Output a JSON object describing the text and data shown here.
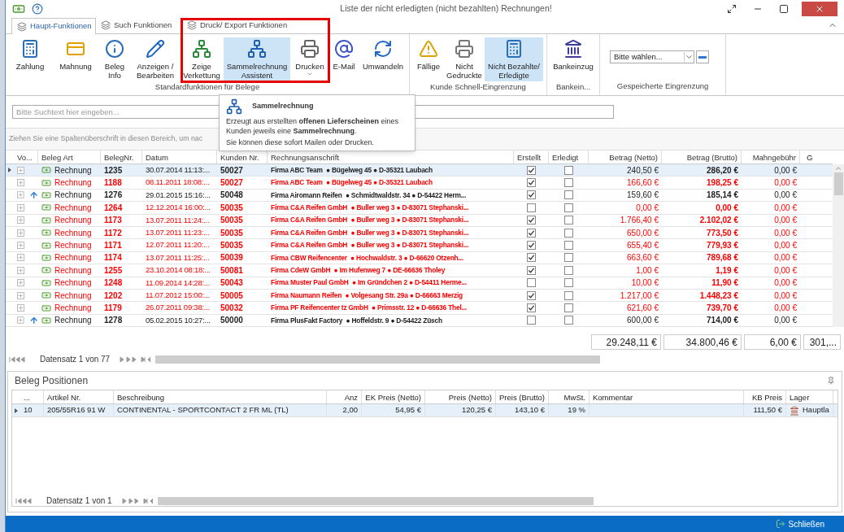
{
  "window": {
    "title": "Liste der nicht erledigten (nicht bezahlten) Rechnungen!"
  },
  "tabs": [
    {
      "label": "Haupt-Funktionen",
      "selected": true
    },
    {
      "label": "Such Funktionen",
      "selected": false
    },
    {
      "label": "Druck/ Export Funktionen",
      "selected": false
    }
  ],
  "ribbon_groups": [
    {
      "label": "Standardfunktionen für Belege",
      "buttons": [
        {
          "kind": "pay",
          "lines": [
            "Zahlung"
          ],
          "selected": false
        },
        {
          "kind": "reminder",
          "lines": [
            "Mahnung"
          ],
          "selected": false
        },
        {
          "kind": "info",
          "lines": [
            "Beleg",
            "Info"
          ],
          "selected": false
        },
        {
          "kind": "edit",
          "lines": [
            "Anzeigen /",
            "Bearbeiten"
          ],
          "selected": false
        },
        {
          "kind": "link",
          "lines": [
            "Zeige",
            "Verkettung"
          ],
          "selected": false
        },
        {
          "kind": "merge",
          "lines": [
            "Sammelrechnung",
            "Assistent"
          ],
          "selected": true
        },
        {
          "kind": "print",
          "lines": [
            "Drucken"
          ],
          "selected": false,
          "dropdown": true
        },
        {
          "kind": "mail",
          "lines": [
            "E-Mail"
          ],
          "selected": false
        },
        {
          "kind": "convert",
          "lines": [
            "Umwandeln"
          ],
          "selected": false
        }
      ]
    },
    {
      "label": "Kunde Schnell-Eingrenzung",
      "buttons": [
        {
          "kind": "warn",
          "lines": [
            "Fällige"
          ],
          "selected": false
        },
        {
          "kind": "printwarn",
          "lines": [
            "Nicht",
            "Gedruckte"
          ],
          "selected": false
        },
        {
          "kind": "paywarn",
          "lines": [
            "Nicht Bezahlte/",
            "Erledigte"
          ],
          "selected": true
        }
      ]
    },
    {
      "label": "Bankein...",
      "buttons": [
        {
          "kind": "bank",
          "lines": [
            "Bankeinzug"
          ],
          "selected": false
        }
      ]
    },
    {
      "label": "Gespeicherte Eingrenzung",
      "select": {
        "value": "Bitte wählen..."
      }
    }
  ],
  "tooltip": {
    "title": "Sammelrechnung",
    "lines": [
      "Erzeugt aus erstellten **offenen Lieferscheinen** eines Kunden jeweils eine **Sammelrechnung**.",
      "Sie können diese sofort Mailen oder Drucken."
    ]
  },
  "search": {
    "placeholder": "Bitte Suchtext hier eingeben..."
  },
  "group_panel_hint": "Ziehen Sie eine Spaltenüberschrift in diesen Bereich, um nac",
  "table": {
    "columns": [
      "Vo...",
      "Beleg Art",
      "BelegNr.",
      "Datum",
      "Kunden Nr.",
      "Rechnungsanschrift",
      "Erstellt",
      "Erledigt",
      "Betrag (Netto)",
      "Betrag (Brutto)",
      "Mahngebühr",
      "G"
    ],
    "rows": [
      {
        "selected": true,
        "overdue": false,
        "arrow": false,
        "type": "Rechnung",
        "number": "1235",
        "date": "30.07.2014 11:13:...",
        "customer": "50027",
        "address": "Firma ABC Team  ● Bügelweg 45 ● D-35321 Laubach",
        "created": true,
        "done": false,
        "net": "240,50 €",
        "gross": "286,20 €",
        "fee": "0,00 €"
      },
      {
        "selected": false,
        "overdue": true,
        "arrow": false,
        "type": "Rechnung",
        "number": "1188",
        "date": "08.11.2011 18:08:...",
        "customer": "50027",
        "address": "Firma ABC Team  ● Bügelweg 45 ● D-35321 Laubach",
        "created": true,
        "done": false,
        "net": "166,60 €",
        "gross": "198,25 €",
        "fee": "0,00 €"
      },
      {
        "selected": false,
        "overdue": false,
        "arrow": true,
        "type": "Rechnung",
        "number": "1276",
        "date": "29.01.2015 15:16:...",
        "customer": "50048",
        "address": "Firma Airomann Reifen  ● Schmidtwaldstr. 34 ● D-54422 Herm...",
        "created": true,
        "done": false,
        "net": "159,60 €",
        "gross": "185,14 €",
        "fee": "0,00 €"
      },
      {
        "selected": false,
        "overdue": true,
        "arrow": false,
        "type": "Rechnung",
        "number": "1264",
        "date": "12.12.2014 16:00:...",
        "customer": "50035",
        "address": "Firma C&A Reifen GmbH  ● Buller weg 3 ● D-83071 Stephanski...",
        "created": false,
        "done": false,
        "net": "0,00 €",
        "gross": "0,00 €",
        "fee": "0,00 €"
      },
      {
        "selected": false,
        "overdue": true,
        "arrow": false,
        "type": "Rechnung",
        "number": "1173",
        "date": "13.07.2011 11:24:...",
        "customer": "50035",
        "address": "Firma C&A Reifen GmbH  ● Buller weg 3 ● D-83071 Stephanski...",
        "created": true,
        "done": false,
        "net": "1.766,40 €",
        "gross": "2.102,02 €",
        "fee": "0,00 €"
      },
      {
        "selected": false,
        "overdue": true,
        "arrow": false,
        "type": "Rechnung",
        "number": "1172",
        "date": "13.07.2011 11:23:...",
        "customer": "50035",
        "address": "Firma C&A Reifen GmbH  ● Buller weg 3 ● D-83071 Stephanski...",
        "created": true,
        "done": false,
        "net": "650,00 €",
        "gross": "773,50 €",
        "fee": "0,00 €"
      },
      {
        "selected": false,
        "overdue": true,
        "arrow": false,
        "type": "Rechnung",
        "number": "1171",
        "date": "12.07.2011 11:20:...",
        "customer": "50035",
        "address": "Firma C&A Reifen GmbH  ● Buller weg 3 ● D-83071 Stephanski...",
        "created": true,
        "done": false,
        "net": "655,40 €",
        "gross": "779,93 €",
        "fee": "0,00 €"
      },
      {
        "selected": false,
        "overdue": true,
        "arrow": false,
        "type": "Rechnung",
        "number": "1174",
        "date": "13.07.2011 11:25:...",
        "customer": "50039",
        "address": "Firma CBW Reifencenter  ● Hochwaldstr. 3 ● D-66620 Otzenh...",
        "created": true,
        "done": false,
        "net": "663,60 €",
        "gross": "789,68 €",
        "fee": "0,00 €"
      },
      {
        "selected": false,
        "overdue": true,
        "arrow": false,
        "type": "Rechnung",
        "number": "1255",
        "date": "23.10.2014 08:18:...",
        "customer": "50081",
        "address": "Firma CdeW GmbH  ● Im Hufenweg 7 ● DE-66636 Tholey",
        "created": true,
        "done": false,
        "net": "1,00 €",
        "gross": "1,19 €",
        "fee": "0,00 €"
      },
      {
        "selected": false,
        "overdue": true,
        "arrow": false,
        "type": "Rechnung",
        "number": "1248",
        "date": "11.09.2014 14:28:...",
        "customer": "50043",
        "address": "Firma Muster Paul GmbH  ● Im Gründchen 2 ● D-54411 Herme...",
        "created": false,
        "done": false,
        "net": "10,00 €",
        "gross": "11,90 €",
        "fee": "0,00 €"
      },
      {
        "selected": false,
        "overdue": true,
        "arrow": false,
        "type": "Rechnung",
        "number": "1202",
        "date": "11.07.2012 15:00:...",
        "customer": "50005",
        "address": "Firma Naumann Reifen  ● Volgesang Str. 29a ● D-66663 Merzig",
        "created": true,
        "done": false,
        "net": "1.217,00 €",
        "gross": "1.448,23 €",
        "fee": "0,00 €"
      },
      {
        "selected": false,
        "overdue": true,
        "arrow": false,
        "type": "Rechnung",
        "number": "1179",
        "date": "26.07.2011 09:38:...",
        "customer": "50032",
        "address": "Firma PF Reifencenter tz GmbH  ● Primsstr. 12 ● D-66636 Thel...",
        "created": true,
        "done": false,
        "net": "621,60 €",
        "gross": "739,70 €",
        "fee": "0,00 €"
      },
      {
        "selected": false,
        "overdue": false,
        "arrow": true,
        "type": "Rechnung",
        "number": "1278",
        "date": "05.02.2015 10:27:...",
        "customer": "50000",
        "address": "Firma PlusFakt Factory  ● Hoffeldstr. 9 ● D-54422 Züsch",
        "created": false,
        "done": false,
        "net": "600,00 €",
        "gross": "714,00 €",
        "fee": "0,00 €"
      }
    ],
    "totals": [
      "29.248,11 €",
      "34.800,46 €",
      "6,00 €",
      "301,..."
    ],
    "pager": "Datensatz 1 von 77"
  },
  "positions": {
    "title": "Beleg Positionen",
    "columns": [
      "...",
      "Artikel Nr.",
      "Beschreibung",
      "Anz",
      "EK Preis (Netto)",
      "Preis (Netto)",
      "Preis (Brutto)",
      "MwSt.",
      "Kommentar",
      "KB Preis",
      "Lager"
    ],
    "rows": [
      {
        "selected": true,
        "cells": [
          "10",
          "205/55R16 91 W",
          "CONTINENTAL - SPORTCONTACT 2 FR ML (TL)",
          "2,00",
          "54,95 €",
          "120,25 €",
          "143,10 €",
          "19 %",
          "",
          "111,50 €",
          "Hauptla"
        ]
      }
    ],
    "pager": "Datensatz 1 von 1"
  },
  "status_bar": {
    "close_label": "Schließen"
  }
}
